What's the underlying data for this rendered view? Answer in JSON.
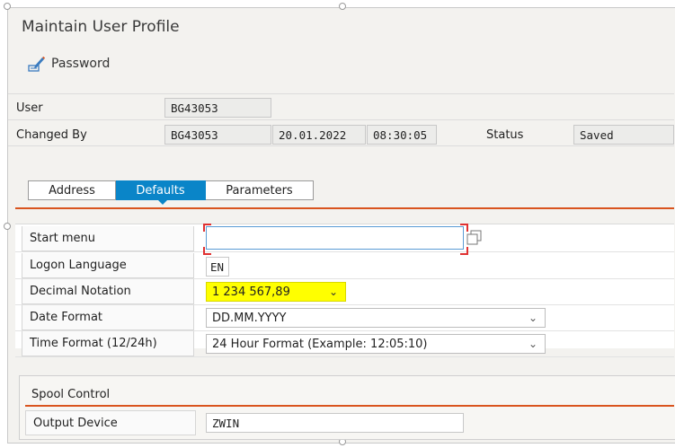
{
  "window": {
    "title": "Maintain User Profile"
  },
  "toolbar": {
    "password_label": "Password"
  },
  "header": {
    "user_label": "User",
    "user_value": "BG43053",
    "changed_by_label": "Changed By",
    "changed_by_value": "BG43053",
    "changed_date": "20.01.2022",
    "changed_time": "08:30:05",
    "status_label": "Status",
    "status_value": "Saved"
  },
  "tabs": [
    {
      "label": "Address",
      "active": false
    },
    {
      "label": "Defaults",
      "active": true
    },
    {
      "label": "Parameters",
      "active": false
    }
  ],
  "defaults": {
    "start_menu_label": "Start menu",
    "start_menu_value": "",
    "logon_language_label": "Logon Language",
    "logon_language_value": "EN",
    "decimal_notation_label": "Decimal Notation",
    "decimal_notation_value": "1 234 567,89",
    "date_format_label": "Date Format",
    "date_format_value": "DD.MM.YYYY",
    "time_format_label": "Time Format (12/24h)",
    "time_format_value": "24 Hour Format (Example: 12:05:10)"
  },
  "spool": {
    "section_title": "Spool Control",
    "output_device_label": "Output Device",
    "output_device_value": "ZWIN"
  },
  "colors": {
    "accent_blue": "#0a85c8",
    "separator_orange": "#d9541e",
    "highlight_yellow": "#ffff00"
  },
  "icons": {
    "password": "pencil-edit-icon",
    "value_help": "copy-icon",
    "dropdown": "chevron-down-icon"
  }
}
